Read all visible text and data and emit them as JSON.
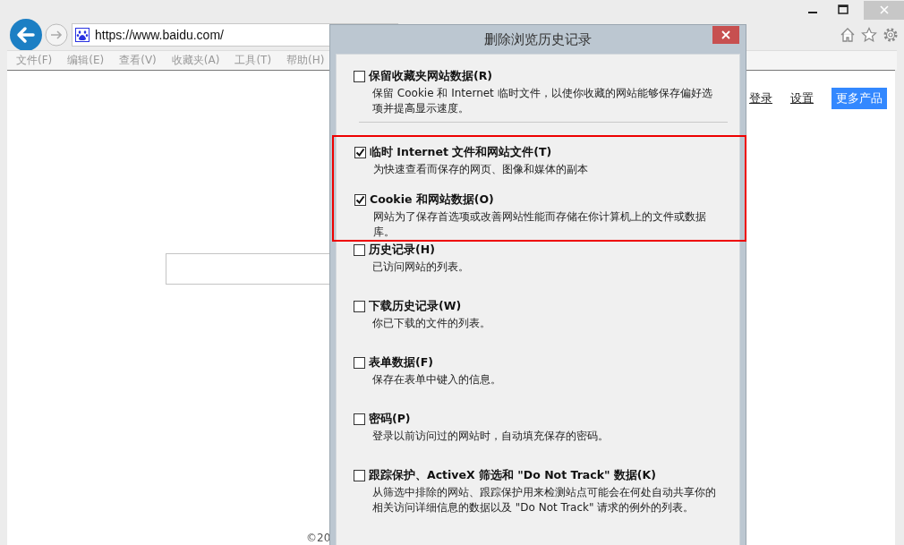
{
  "browser": {
    "address": "https://www.baidu.com/",
    "menu": [
      "文件(F)",
      "编辑(E)",
      "查看(V)",
      "收藏夹(A)",
      "工具(T)",
      "帮助(H)"
    ]
  },
  "page": {
    "links": [
      {
        "label": "登录",
        "kind": "link"
      },
      {
        "label": "设置",
        "kind": "link"
      },
      {
        "label": "更多产品",
        "kind": "button"
      }
    ],
    "footer": "©20"
  },
  "dialog": {
    "title": "删除浏览历史记录",
    "options": [
      {
        "label": "保留收藏夹网站数据(R)",
        "description": "保留 Cookie 和 Internet 临时文件，以使你收藏的网站能够保存偏好选项并提高显示速度。",
        "checked": false,
        "highlighted": false
      },
      {
        "label": "临时 Internet 文件和网站文件(T)",
        "description": "为快速查看而保存的网页、图像和媒体的副本",
        "checked": true,
        "highlighted": true
      },
      {
        "label": "Cookie 和网站数据(O)",
        "description": "网站为了保存首选项或改善网站性能而存储在你计算机上的文件或数据库。",
        "checked": true,
        "highlighted": true
      },
      {
        "label": "历史记录(H)",
        "description": "已访问网站的列表。",
        "checked": false,
        "highlighted": false
      },
      {
        "label": "下载历史记录(W)",
        "description": "你已下载的文件的列表。",
        "checked": false,
        "highlighted": false
      },
      {
        "label": "表单数据(F)",
        "description": "保存在表单中键入的信息。",
        "checked": false,
        "highlighted": false
      },
      {
        "label": "密码(P)",
        "description": "登录以前访问过的网站时，自动填充保存的密码。",
        "checked": false,
        "highlighted": false
      },
      {
        "label": "跟踪保护、ActiveX 筛选和 \"Do Not Track\" 数据(K)",
        "description": "从筛选中排除的网站、跟踪保护用来检测站点可能会在何处自动共享你的相关访问详细信息的数据以及 \"Do Not Track\" 请求的例外的列表。",
        "checked": false,
        "highlighted": false
      }
    ]
  }
}
